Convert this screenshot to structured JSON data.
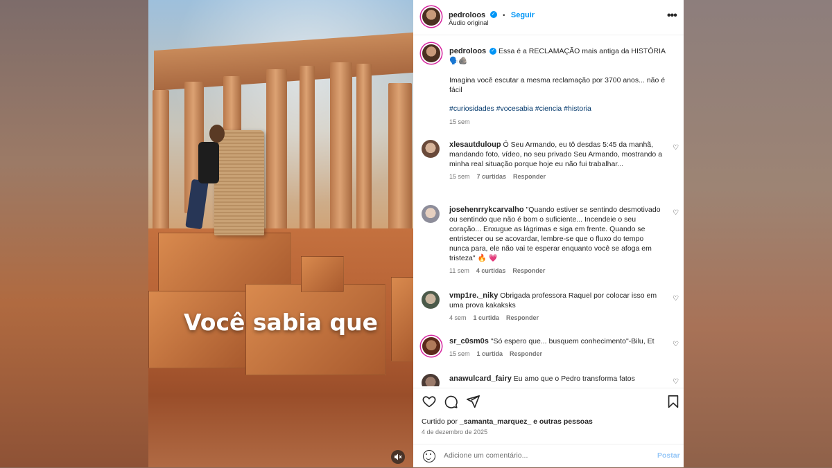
{
  "video": {
    "caption": "Você sabia que",
    "mute_icon": "speaker-muted-icon"
  },
  "header": {
    "username": "pedroloos",
    "separator": "•",
    "follow_label": "Seguir",
    "audio_label": "Áudio original",
    "more_icon": "more-horizontal-icon"
  },
  "post": {
    "username": "pedroloos",
    "title": "Essa é a RECLAMAÇÃO mais antiga da HISTÓRIA",
    "emojis": "🗣️🪨",
    "body": "Imagina você escutar a mesma reclamação por 3700 anos... não é fácil",
    "hashtags": "#curiosidades #vocesabia #ciencia #historia",
    "time": "15 sem"
  },
  "comments": [
    {
      "username": "xlesautduloup",
      "text": "Ô Seu Armando, eu tô desdas 5:45 da manhã, mandando foto, vídeo, no seu privado Seu Armando, mostrando a minha real situação porque hoje eu não fui trabalhar...",
      "time": "15 sem",
      "likes": "7 curtidas",
      "reply": "Responder"
    },
    {
      "username": "josehenrrykcarvalho",
      "text": "\"Quando estiver se sentindo desmotivado ou sentindo que não é bom o suficiente... Incendeie o seu coração... Enxugue as lágrimas e siga em frente. Quando se entristecer ou se acovardar, lembre-se que o fluxo do tempo nunca para, ele não vai te esperar enquanto você se afoga em tristeza\" 🔥 💗",
      "time": "11 sem",
      "likes": "4 curtidas",
      "reply": "Responder"
    },
    {
      "username": "vmp1re._niky",
      "text": "Obrigada professora Raquel por colocar isso em uma prova kakaksks",
      "time": "4 sem",
      "likes": "1 curtida",
      "reply": "Responder"
    },
    {
      "username": "sr_c0sm0s",
      "text": "\"Só espero que... busquem conhecimento\"-Bilu, Et",
      "time": "15 sem",
      "likes": "1 curtida",
      "reply": "Responder"
    },
    {
      "username": "anawulcard_fairy",
      "text": "Eu amo que o Pedro transforma fatos"
    }
  ],
  "actions": {
    "like_icon": "heart-icon",
    "comment_icon": "comment-icon",
    "share_icon": "send-icon",
    "save_icon": "bookmark-icon",
    "liked_by_prefix": "Curtido por",
    "liked_by_user": "_samanta_marquez_",
    "liked_by_suffix": "e outras pessoas",
    "date": "4 de dezembro de 2025"
  },
  "comment_box": {
    "placeholder": "Adicione um comentário...",
    "post_label": "Postar",
    "emoji_icon": "emoji-icon"
  },
  "colors": {
    "accent": "#0095f6",
    "link": "#00376b",
    "muted": "#737373"
  }
}
